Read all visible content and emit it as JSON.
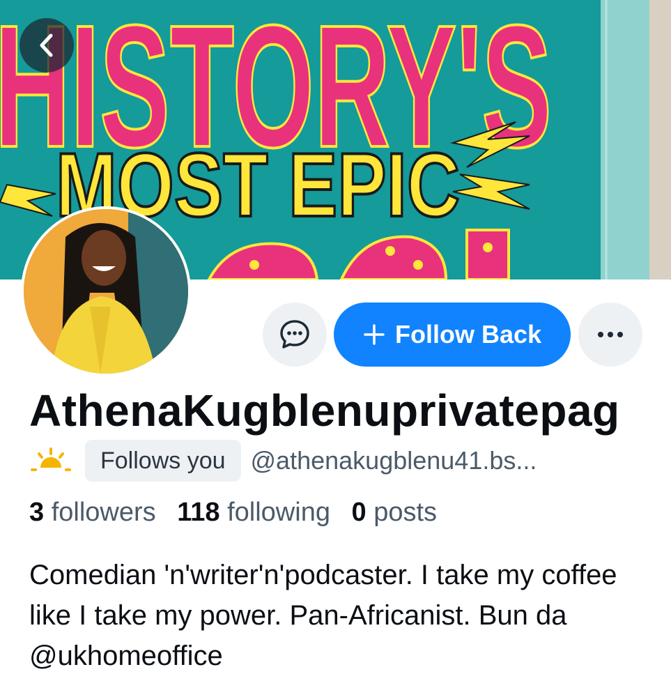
{
  "banner": {
    "line1": "HISTORY'S",
    "line2": "MOST EPIC",
    "colors": {
      "teal": "#139a99",
      "pink": "#e8327c",
      "yellow": "#ffe63b"
    }
  },
  "nav": {
    "back_icon": "chevron-left-icon"
  },
  "actions": {
    "message_icon": "chat-bubble-icon",
    "follow_label": "Follow Back",
    "follow_icon": "plus-icon",
    "more_icon": "ellipsis-icon",
    "accent": "#1183fe"
  },
  "profile": {
    "display_name": "AthenaKugblenuprivatepag",
    "sun_icon": "sun-icon",
    "follows_you": "Follows you",
    "handle": "@athenakugblenu41.bs...",
    "stats": {
      "followers_count": "3",
      "followers_label": "followers",
      "following_count": "118",
      "following_label": "following",
      "posts_count": "0",
      "posts_label": "posts"
    },
    "bio": "Comedian 'n'writer'n'podcaster. I take my coffee like I take my power. Pan-Africanist. Bun da @ukhomeoffice"
  }
}
